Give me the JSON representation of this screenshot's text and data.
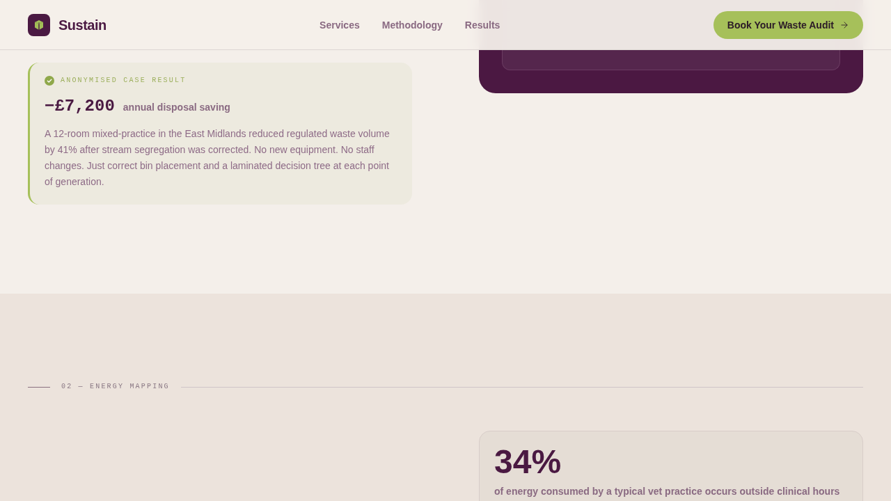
{
  "header": {
    "brand": "Sustain",
    "nav": [
      {
        "label": "Services"
      },
      {
        "label": "Methodology"
      },
      {
        "label": "Results"
      }
    ],
    "cta": "Book Your Waste Audit"
  },
  "case_result": {
    "label": "ANONYMISED CASE RESULT",
    "value": "−£7,200",
    "caption": "annual disposal saving",
    "body": "A 12-room mixed-practice in the East Midlands reduced regulated waste volume by 41% after stream segregation was corrected. No new equipment. No staff changes. Just correct bin placement and a laminated decision tree at each point of generation."
  },
  "energy_section": {
    "label": "02 — ENERGY MAPPING",
    "stat": {
      "value": "34%",
      "description": "of energy consumed by a typical vet practice occurs outside clinical hours"
    }
  }
}
